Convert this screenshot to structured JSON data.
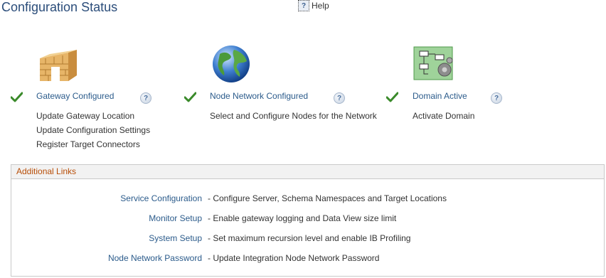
{
  "page": {
    "title": "Configuration Status",
    "help_label": "Help"
  },
  "statuses": [
    {
      "heading": "Gateway Configured",
      "icon": "gateway-wall-icon",
      "links": [
        "Update Gateway Location",
        "Update Configuration Settings",
        "Register Target Connectors"
      ]
    },
    {
      "heading": "Node Network Configured",
      "icon": "globe-icon",
      "links": [
        "Select and Configure Nodes for the Network"
      ]
    },
    {
      "heading": "Domain Active",
      "icon": "domain-flowchart-icon",
      "links": [
        "Activate Domain"
      ]
    }
  ],
  "additional_links": {
    "title": "Additional Links",
    "items": [
      {
        "label": "Service Configuration",
        "description": "- Configure Server, Schema Namespaces and Target Locations"
      },
      {
        "label": "Monitor Setup",
        "description": "- Enable gateway logging and Data View size limit"
      },
      {
        "label": "System Setup",
        "description": "- Set maximum recursion level and enable IB Profiling"
      },
      {
        "label": "Node Network Password",
        "description": "- Update Integration Node Network Password"
      }
    ]
  },
  "colors": {
    "title": "#2b4d7a",
    "link": "#2b5b8b",
    "section_header": "#b84e08",
    "check": "#3a8a2a"
  }
}
